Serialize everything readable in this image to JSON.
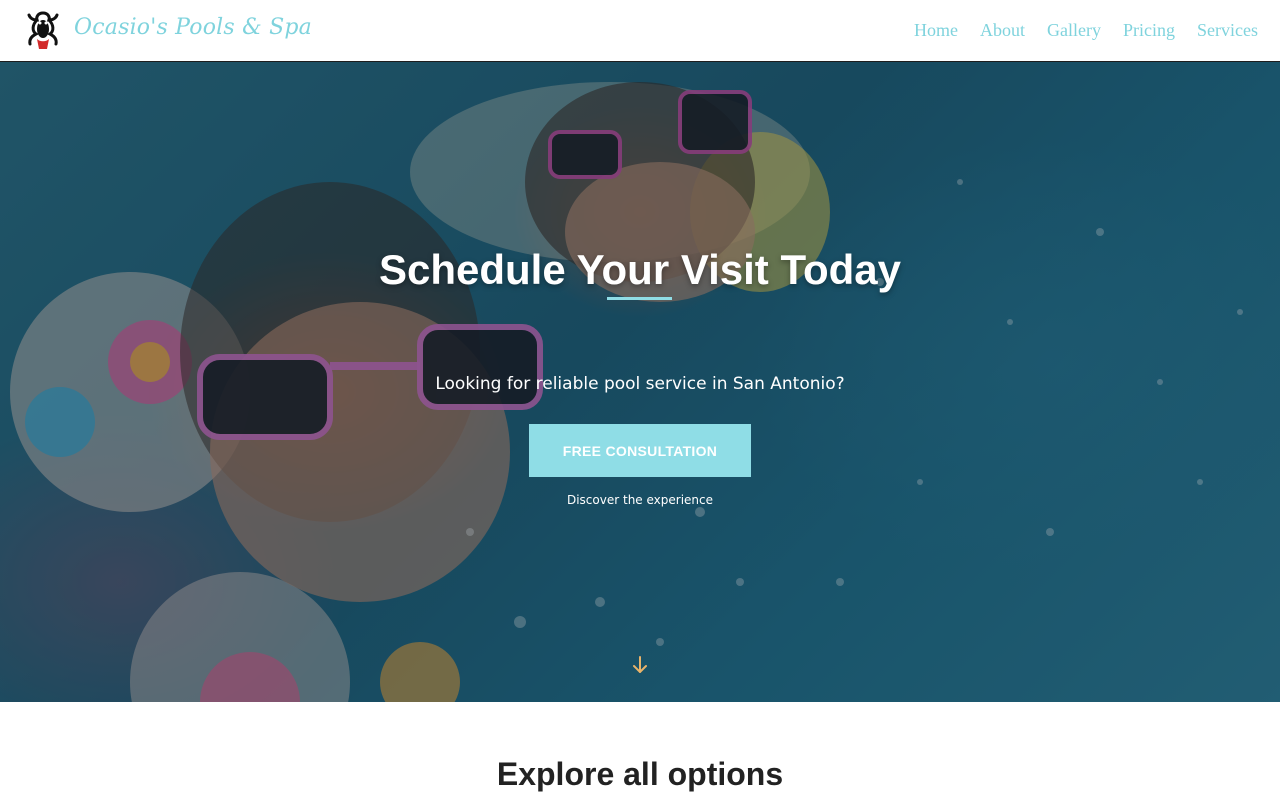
{
  "header": {
    "brand": "Ocasio's Pools & Spa",
    "logo_icon": "frog-icon",
    "nav": [
      "Home",
      "About",
      "Gallery",
      "Pricing",
      "Services"
    ]
  },
  "hero": {
    "title": "Schedule Your Visit Today",
    "subtitle": "Looking for reliable pool service in San Antonio?",
    "cta_label": "FREE CONSULTATION",
    "caption": "Discover the experience",
    "scroll_icon": "arrow-down-icon"
  },
  "section": {
    "title": "Explore all options"
  },
  "colors": {
    "accent": "#8fdde6",
    "brand_text": "#7fd3dd",
    "arrow": "#e8b36a",
    "heading": "#222222"
  }
}
